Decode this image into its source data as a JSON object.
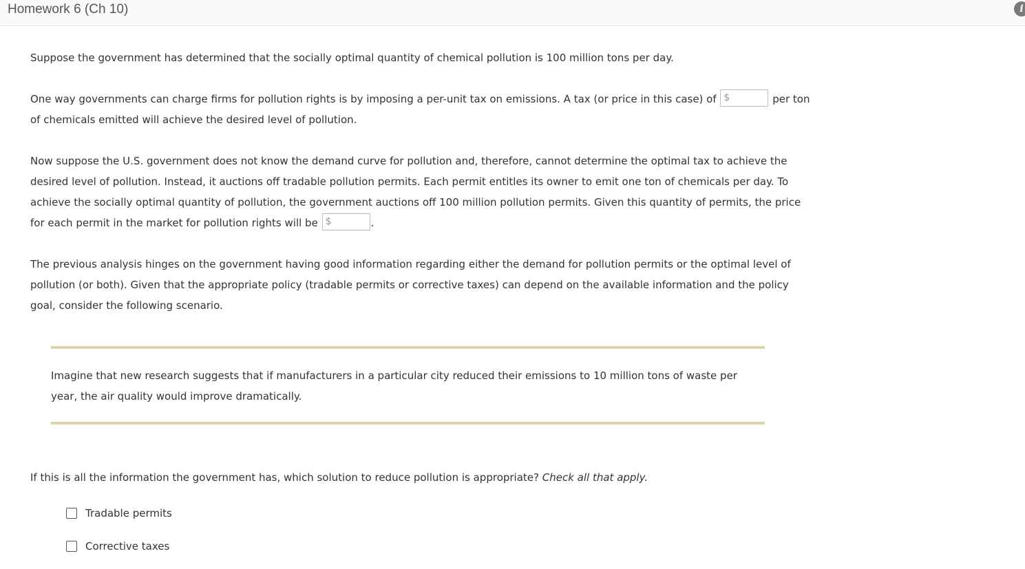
{
  "header": {
    "title": "Homework 6 (Ch 10)",
    "info_icon": "info-icon"
  },
  "paragraphs": {
    "p1": "Suppose the government has determined that the socially optimal quantity of chemical pollution is 100 million tons per day.",
    "p2_before": "One way governments can charge firms for pollution rights is by imposing a per-unit tax on emissions. A tax (or price in this case) of",
    "p2_after": "per ton of chemicals emitted will achieve the desired level of pollution.",
    "p3_before": "Now suppose the U.S. government does not know the demand curve for pollution and, therefore, cannot determine the optimal tax to achieve the desired level of pollution. Instead, it auctions off tradable pollution permits. Each permit entitles its owner to emit one ton of chemicals per day. To achieve the socially optimal quantity of pollution, the government auctions off 100 million pollution permits. Given this quantity of permits, the price for each permit in the market for pollution rights will be",
    "p3_after": ".",
    "p4": "The previous analysis hinges on the government having good information regarding either the demand for pollution permits or the optimal level of pollution (or both). Given that the appropriate policy (tradable permits or corrective taxes) can depend on the available information and the policy goal, consider the following scenario."
  },
  "inputs": {
    "tax_price": {
      "currency": "$",
      "value": ""
    },
    "permit_price": {
      "currency": "$",
      "value": ""
    }
  },
  "scenario": {
    "text": "Imagine that new research suggests that if manufacturers in a particular city reduced their emissions to 10 million tons of waste per year, the air quality would improve dramatically."
  },
  "question": {
    "text": "If this is all the information the government has, which solution to reduce pollution is appropriate?",
    "instruction": "Check all that apply."
  },
  "options": [
    {
      "label": "Tradable permits",
      "checked": false
    },
    {
      "label": "Corrective taxes",
      "checked": false
    }
  ],
  "colors": {
    "rule": "#ddd3ad",
    "text": "#333333"
  }
}
